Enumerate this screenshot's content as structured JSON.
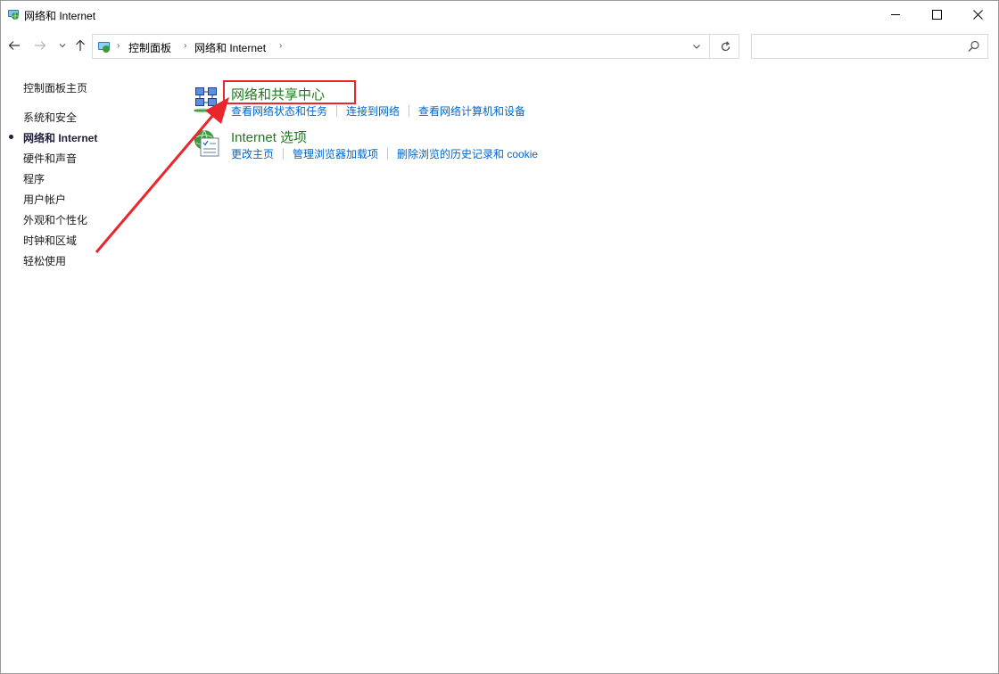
{
  "window": {
    "title": "网络和 Internet"
  },
  "navigation": {
    "breadcrumbs": [
      "控制面板",
      "网络和 Internet"
    ],
    "search_placeholder": ""
  },
  "leftnav": {
    "items": [
      {
        "label": "控制面板主页",
        "current": false
      },
      {
        "label": "系统和安全",
        "current": false
      },
      {
        "label": "网络和 Internet",
        "current": true
      },
      {
        "label": "硬件和声音",
        "current": false
      },
      {
        "label": "程序",
        "current": false
      },
      {
        "label": "用户帐户",
        "current": false
      },
      {
        "label": "外观和个性化",
        "current": false
      },
      {
        "label": "时钟和区域",
        "current": false
      },
      {
        "label": "轻松使用",
        "current": false
      }
    ]
  },
  "categories": [
    {
      "title": "网络和共享中心",
      "icon": "network-sharing-center-icon",
      "links": [
        "查看网络状态和任务",
        "连接到网络",
        "查看网络计算机和设备"
      ]
    },
    {
      "title": "Internet 选项",
      "icon": "internet-options-icon",
      "links": [
        "更改主页",
        "管理浏览器加载项",
        "删除浏览的历史记录和 cookie"
      ]
    }
  ],
  "colors": {
    "category_title": "#1e7a1e",
    "link": "#0066cc",
    "annotation": "#e8262c"
  }
}
